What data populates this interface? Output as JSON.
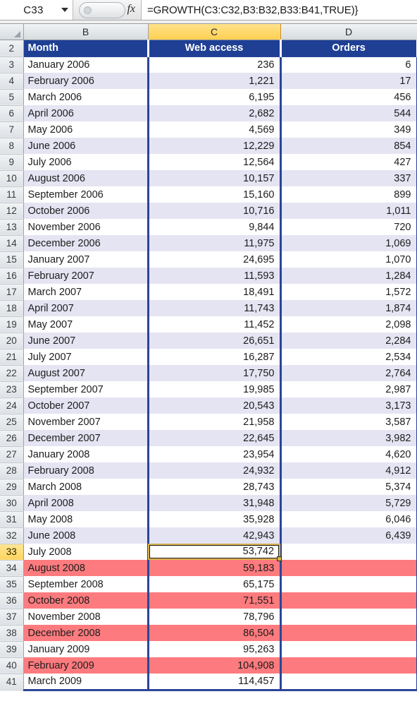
{
  "formula_bar": {
    "name_box_value": "C33",
    "name_box_dropdown_icon": "chevron-down-icon",
    "function_icon": "fx-icon",
    "function_icon_label": "fx",
    "formula_value": "=GROWTH(C3:C32,B3:B32,B33:B41,TRUE)}"
  },
  "grid": {
    "corner_icon": "select-all-triangle-icon",
    "column_headers": [
      "B",
      "C",
      "D"
    ],
    "selected_column": "C",
    "selected_row": "33",
    "active_cell": "C33",
    "table_header_row_number": "2",
    "table_headers": [
      "Month",
      "Web access",
      "Orders"
    ],
    "colors": {
      "header_blue": "#1F3F94",
      "band_lavender": "#E5E4F3",
      "band_salmon": "#FD7B7E",
      "table_rule_blue": "#2B4596",
      "selection_gold": "#FFD45E",
      "active_cell_border": "#D8B34A"
    },
    "rows": [
      {
        "n": "3",
        "month": "January 2006",
        "web": "236",
        "orders": "6",
        "band": "white"
      },
      {
        "n": "4",
        "month": "February 2006",
        "web": "1,221",
        "orders": "17",
        "band": "lav"
      },
      {
        "n": "5",
        "month": "March 2006",
        "web": "6,195",
        "orders": "456",
        "band": "white"
      },
      {
        "n": "6",
        "month": "April 2006",
        "web": "2,682",
        "orders": "544",
        "band": "lav"
      },
      {
        "n": "7",
        "month": "May 2006",
        "web": "4,569",
        "orders": "349",
        "band": "white"
      },
      {
        "n": "8",
        "month": "June 2006",
        "web": "12,229",
        "orders": "854",
        "band": "lav"
      },
      {
        "n": "9",
        "month": "July 2006",
        "web": "12,564",
        "orders": "427",
        "band": "white"
      },
      {
        "n": "10",
        "month": "August 2006",
        "web": "10,157",
        "orders": "337",
        "band": "lav"
      },
      {
        "n": "11",
        "month": "September 2006",
        "web": "15,160",
        "orders": "899",
        "band": "white"
      },
      {
        "n": "12",
        "month": "October 2006",
        "web": "10,716",
        "orders": "1,011",
        "band": "lav"
      },
      {
        "n": "13",
        "month": "November 2006",
        "web": "9,844",
        "orders": "720",
        "band": "white"
      },
      {
        "n": "14",
        "month": "December 2006",
        "web": "11,975",
        "orders": "1,069",
        "band": "lav"
      },
      {
        "n": "15",
        "month": "January 2007",
        "web": "24,695",
        "orders": "1,070",
        "band": "white"
      },
      {
        "n": "16",
        "month": "February 2007",
        "web": "11,593",
        "orders": "1,284",
        "band": "lav"
      },
      {
        "n": "17",
        "month": "March 2007",
        "web": "18,491",
        "orders": "1,572",
        "band": "white"
      },
      {
        "n": "18",
        "month": "April 2007",
        "web": "11,743",
        "orders": "1,874",
        "band": "lav"
      },
      {
        "n": "19",
        "month": "May 2007",
        "web": "11,452",
        "orders": "2,098",
        "band": "white"
      },
      {
        "n": "20",
        "month": "June 2007",
        "web": "26,651",
        "orders": "2,284",
        "band": "lav"
      },
      {
        "n": "21",
        "month": "July 2007",
        "web": "16,287",
        "orders": "2,534",
        "band": "white"
      },
      {
        "n": "22",
        "month": "August 2007",
        "web": "17,750",
        "orders": "2,764",
        "band": "lav"
      },
      {
        "n": "23",
        "month": "September 2007",
        "web": "19,985",
        "orders": "2,987",
        "band": "white"
      },
      {
        "n": "24",
        "month": "October 2007",
        "web": "20,543",
        "orders": "3,173",
        "band": "lav"
      },
      {
        "n": "25",
        "month": "November 2007",
        "web": "21,958",
        "orders": "3,587",
        "band": "white"
      },
      {
        "n": "26",
        "month": "December 2007",
        "web": "22,645",
        "orders": "3,982",
        "band": "lav"
      },
      {
        "n": "27",
        "month": "January 2008",
        "web": "23,954",
        "orders": "4,620",
        "band": "white"
      },
      {
        "n": "28",
        "month": "February 2008",
        "web": "24,932",
        "orders": "4,912",
        "band": "lav"
      },
      {
        "n": "29",
        "month": "March 2008",
        "web": "28,743",
        "orders": "5,374",
        "band": "white"
      },
      {
        "n": "30",
        "month": "April 2008",
        "web": "31,948",
        "orders": "5,729",
        "band": "lav"
      },
      {
        "n": "31",
        "month": "May 2008",
        "web": "35,928",
        "orders": "6,046",
        "band": "white"
      },
      {
        "n": "32",
        "month": "June 2008",
        "web": "42,943",
        "orders": "6,439",
        "band": "lav"
      },
      {
        "n": "33",
        "month": "July 2008",
        "web": "53,742",
        "orders": "",
        "band": "white"
      },
      {
        "n": "34",
        "month": "August 2008",
        "web": "59,183",
        "orders": "",
        "band": "salmon"
      },
      {
        "n": "35",
        "month": "September 2008",
        "web": "65,175",
        "orders": "",
        "band": "white"
      },
      {
        "n": "36",
        "month": "October 2008",
        "web": "71,551",
        "orders": "",
        "band": "salmon"
      },
      {
        "n": "37",
        "month": "November 2008",
        "web": "78,796",
        "orders": "",
        "band": "white"
      },
      {
        "n": "38",
        "month": "December 2008",
        "web": "86,504",
        "orders": "",
        "band": "salmon"
      },
      {
        "n": "39",
        "month": "January 2009",
        "web": "95,263",
        "orders": "",
        "band": "white"
      },
      {
        "n": "40",
        "month": "February 2009",
        "web": "104,908",
        "orders": "",
        "band": "salmon"
      },
      {
        "n": "41",
        "month": "March 2009",
        "web": "114,457",
        "orders": "",
        "band": "white"
      }
    ]
  }
}
